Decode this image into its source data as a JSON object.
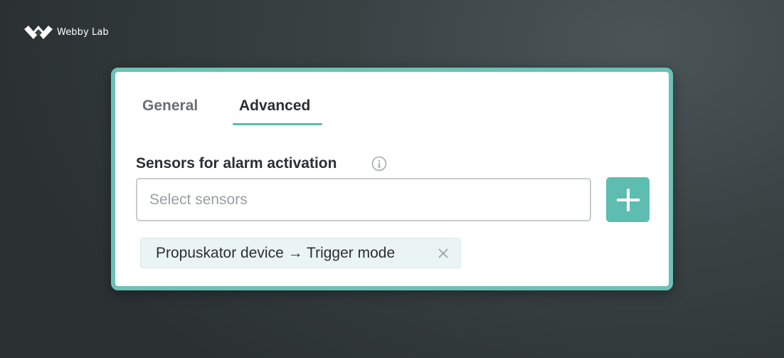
{
  "brand": {
    "name": "Webby Lab",
    "logo_icon": "webbylab-logo-icon"
  },
  "tabs": [
    {
      "label": "General",
      "active": false
    },
    {
      "label": "Advanced",
      "active": true
    }
  ],
  "section": {
    "label": "Sensors for alarm activation",
    "info_icon": "info-icon"
  },
  "sensor_select": {
    "value": "",
    "placeholder": "Select sensors"
  },
  "add_button": {
    "icon": "plus-icon"
  },
  "selected_sensors": [
    {
      "label": "Propuskator device → Trigger mode",
      "remove_icon": "close-icon"
    }
  ],
  "colors": {
    "accent": "#5dbdb1",
    "card_border": "#6cc1b6",
    "chip_background": "#eaf4f3",
    "text_primary": "#2b2f33",
    "text_secondary": "#6b6f72",
    "background": "#353c3e"
  }
}
